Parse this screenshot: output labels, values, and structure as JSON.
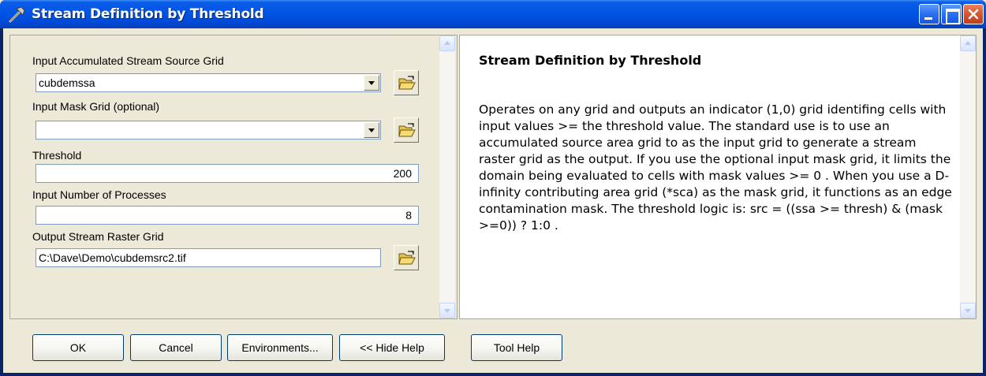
{
  "window": {
    "title": "Stream Definition by Threshold"
  },
  "form": {
    "ssa_label": "Input Accumulated Stream Source Grid",
    "ssa_value": "cubdemssa",
    "mask_label": "Input Mask Grid (optional)",
    "mask_value": "",
    "threshold_label": "Threshold",
    "threshold_value": "200",
    "procs_label": "Input Number of Processes",
    "procs_value": "8",
    "output_label": "Output Stream Raster Grid",
    "output_value": "C:\\Dave\\Demo\\cubdemsrc2.tif"
  },
  "help": {
    "title": "Stream Definition by Threshold",
    "body": "Operates on any grid and outputs an indicator (1,0) grid identifing cells with input values >= the threshold value. The standard use is to use an accumulated source area grid to as the input grid to generate a stream raster grid as the output. If you use the optional input mask grid, it limits the domain being evaluated to cells with mask values >= 0 . When you use a D-infinity contributing area grid (*sca) as the mask grid, it functions as an edge contamination mask. The threshold logic is: src = ((ssa >= thresh) & (mask >=0)) ? 1:0 ."
  },
  "buttons": {
    "ok": "OK",
    "cancel": "Cancel",
    "environments": "Environments...",
    "hide_help": "<< Hide Help",
    "tool_help": "Tool Help"
  },
  "colors": {
    "titlebar": "#0055e5",
    "close_button": "#d8532f",
    "dialog_bg": "#ece9d8"
  }
}
